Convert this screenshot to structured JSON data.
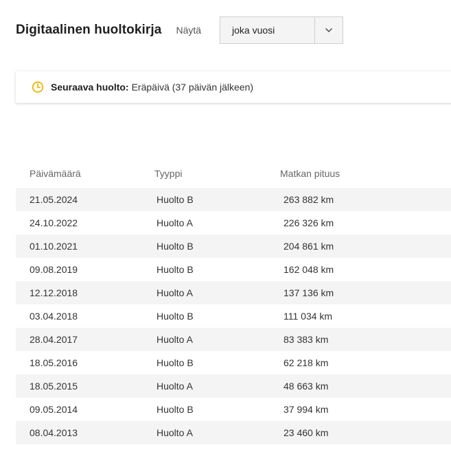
{
  "header": {
    "title": "Digitaalinen huoltokirja",
    "show_label": "Näytä"
  },
  "filter": {
    "selected": "joka vuosi",
    "icon": "chevron-down-icon"
  },
  "notice": {
    "icon": "clock-icon",
    "icon_color": "#f0b400",
    "label": "Seuraava huolto:",
    "text": "Eräpäivä (37 päivän jälkeen)"
  },
  "table": {
    "columns": [
      "Päivämäärä",
      "Tyyppi",
      "Matkan pituus"
    ],
    "rows": [
      {
        "date": "21.05.2024",
        "type": "Huolto B",
        "distance": "263 882 km"
      },
      {
        "date": "24.10.2022",
        "type": "Huolto A",
        "distance": "226 326 km"
      },
      {
        "date": "01.10.2021",
        "type": "Huolto B",
        "distance": "204 861 km"
      },
      {
        "date": "09.08.2019",
        "type": "Huolto B",
        "distance": "162 048 km"
      },
      {
        "date": "12.12.2018",
        "type": "Huolto A",
        "distance": "137 136 km"
      },
      {
        "date": "03.04.2018",
        "type": "Huolto B",
        "distance": "111 034 km"
      },
      {
        "date": "28.04.2017",
        "type": "Huolto A",
        "distance": "83 383 km"
      },
      {
        "date": "18.05.2016",
        "type": "Huolto B",
        "distance": "62 218 km"
      },
      {
        "date": "18.05.2015",
        "type": "Huolto A",
        "distance": "48 663 km"
      },
      {
        "date": "09.05.2014",
        "type": "Huolto B",
        "distance": "37 994 km"
      },
      {
        "date": "08.04.2013",
        "type": "Huolto A",
        "distance": "23 460 km"
      }
    ]
  }
}
